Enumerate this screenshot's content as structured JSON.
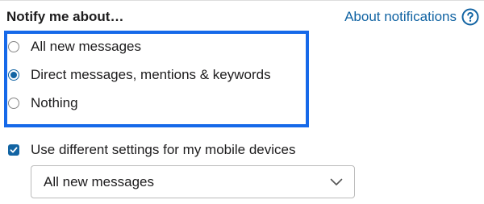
{
  "notify": {
    "title": "Notify me about…",
    "about_link": "About notifications",
    "options": [
      {
        "label": "All new messages",
        "selected": false
      },
      {
        "label": "Direct messages, mentions & keywords",
        "selected": true
      },
      {
        "label": "Nothing",
        "selected": false
      }
    ]
  },
  "mobile": {
    "checkbox_label": "Use different settings for my mobile devices",
    "checked": true,
    "select_value": "All new messages"
  },
  "icons": {
    "help": "question-circle-icon",
    "chevron": "chevron-down-icon",
    "checkmark": "checkmark-icon"
  },
  "colors": {
    "accent": "#1264a3",
    "highlight_border": "#1669e9",
    "text": "#1d1c1d",
    "link": "#1264a3"
  }
}
